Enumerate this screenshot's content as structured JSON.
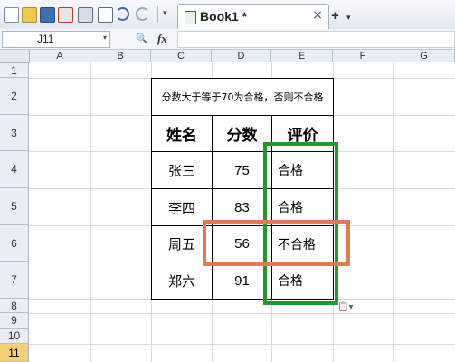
{
  "toolbar": {
    "tab_title": "Book1 *",
    "tab_close": "×",
    "new_tab": "+",
    "new_tab_dropdown": "▾",
    "icons": [
      "new-doc-icon",
      "open-folder-icon",
      "save-icon",
      "export-pdf-icon",
      "print-icon",
      "print-preview-icon",
      "undo-icon",
      "redo-icon",
      "toolbar-dropdown-icon"
    ]
  },
  "formula_bar": {
    "name_box": "J11",
    "name_box_dropdown": "▾",
    "zoom_icon": "🔍",
    "fx_label": "fx",
    "formula": ""
  },
  "columns": [
    "A",
    "B",
    "C",
    "D",
    "E",
    "F",
    "G"
  ],
  "rows": [
    "1",
    "2",
    "3",
    "4",
    "5",
    "6",
    "7",
    "8",
    "9",
    "10",
    "11"
  ],
  "active_row": "11",
  "table": {
    "title": "分数大于等于70为合格，否则不合格",
    "headers": [
      "姓名",
      "分数",
      "评价"
    ],
    "records": [
      {
        "name": "张三",
        "score": "75",
        "eval": "合格"
      },
      {
        "name": "李四",
        "score": "83",
        "eval": "合格"
      },
      {
        "name": "周五",
        "score": "56",
        "eval": "不合格"
      },
      {
        "name": "郑六",
        "score": "91",
        "eval": "合格"
      }
    ]
  },
  "highlights": {
    "eval_column": "#1f9a2c",
    "failing_row": "#e27a55"
  },
  "paste_options": "📋▾"
}
